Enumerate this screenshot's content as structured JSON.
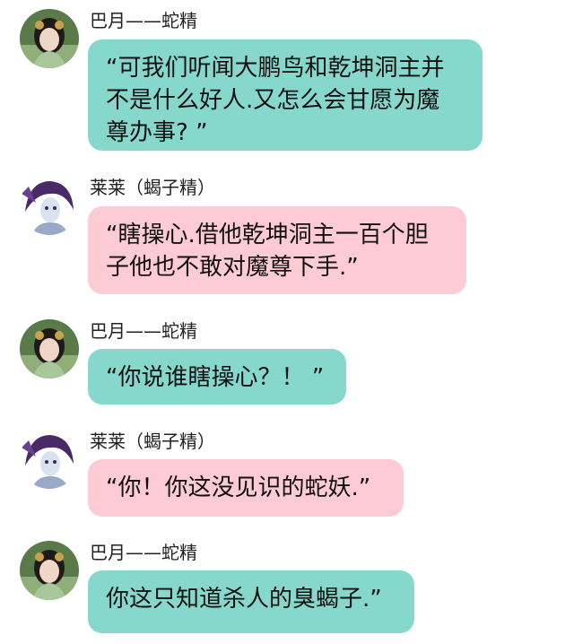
{
  "messages": [
    {
      "sender": "巴月——蛇精",
      "avatar_icon": "female-character-avatar-icon",
      "color": "#86d8cd",
      "lines": [
        "“可我们听闻大鹏鸟和乾坤洞主并",
        "不是什么好人.又怎么会甘愿为魔",
        "尊办事? ”"
      ]
    },
    {
      "sender": "莱莱（蝎子精）",
      "avatar_icon": "purple-hair-character-avatar-icon",
      "color": "#fccbd6",
      "lines": [
        "“瞎操心.借他乾坤洞主一百个胆",
        "子他也不敢对魔尊下手.”"
      ]
    },
    {
      "sender": "巴月——蛇精",
      "avatar_icon": "female-character-avatar-icon",
      "color": "#86d8cd",
      "lines": [
        "“你说谁瞎操心？！ ”"
      ]
    },
    {
      "sender": "莱莱（蝎子精）",
      "avatar_icon": "purple-hair-character-avatar-icon",
      "color": "#fccbd6",
      "lines": [
        "“你！你这没见识的蛇妖.”"
      ]
    },
    {
      "sender": "巴月——蛇精",
      "avatar_icon": "female-character-avatar-icon",
      "color": "#86d8cd",
      "lines": [
        "你这只知道杀人的臭蝎子.”"
      ]
    }
  ]
}
